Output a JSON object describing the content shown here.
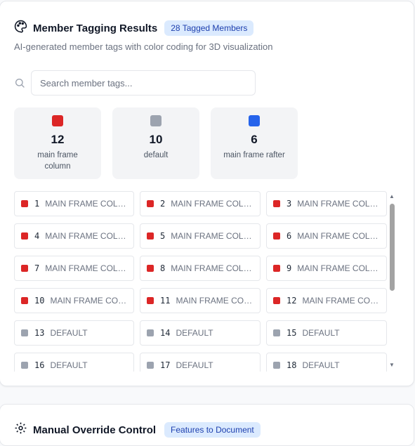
{
  "header": {
    "title": "Member Tagging Results",
    "badge": "28 Tagged Members",
    "subtitle": "AI-generated member tags with color coding for 3D visualization"
  },
  "search": {
    "placeholder": "Search member tags..."
  },
  "colors": {
    "red": "#dc2626",
    "gray": "#9ca3af",
    "blue": "#2563eb"
  },
  "stats": [
    {
      "count": "12",
      "label": "main frame column",
      "color": "#dc2626"
    },
    {
      "count": "10",
      "label": "default",
      "color": "#9ca3af"
    },
    {
      "count": "6",
      "label": "main frame rafter",
      "color": "#2563eb"
    }
  ],
  "members": [
    {
      "num": "1",
      "label": "MAIN FRAME COLU...",
      "color": "#dc2626"
    },
    {
      "num": "2",
      "label": "MAIN FRAME COLU...",
      "color": "#dc2626"
    },
    {
      "num": "3",
      "label": "MAIN FRAME COLU...",
      "color": "#dc2626"
    },
    {
      "num": "4",
      "label": "MAIN FRAME COLU...",
      "color": "#dc2626"
    },
    {
      "num": "5",
      "label": "MAIN FRAME COLU...",
      "color": "#dc2626"
    },
    {
      "num": "6",
      "label": "MAIN FRAME COLU...",
      "color": "#dc2626"
    },
    {
      "num": "7",
      "label": "MAIN FRAME COLU...",
      "color": "#dc2626"
    },
    {
      "num": "8",
      "label": "MAIN FRAME COLU...",
      "color": "#dc2626"
    },
    {
      "num": "9",
      "label": "MAIN FRAME COLU...",
      "color": "#dc2626"
    },
    {
      "num": "10",
      "label": "MAIN FRAME COL...",
      "color": "#dc2626"
    },
    {
      "num": "11",
      "label": "MAIN FRAME COL...",
      "color": "#dc2626"
    },
    {
      "num": "12",
      "label": "MAIN FRAME COL...",
      "color": "#dc2626"
    },
    {
      "num": "13",
      "label": "DEFAULT",
      "color": "#9ca3af"
    },
    {
      "num": "14",
      "label": "DEFAULT",
      "color": "#9ca3af"
    },
    {
      "num": "15",
      "label": "DEFAULT",
      "color": "#9ca3af"
    },
    {
      "num": "16",
      "label": "DEFAULT",
      "color": "#9ca3af"
    },
    {
      "num": "17",
      "label": "DEFAULT",
      "color": "#9ca3af"
    },
    {
      "num": "18",
      "label": "DEFAULT",
      "color": "#9ca3af"
    }
  ],
  "section2": {
    "title": "Manual Override Control",
    "badge": "Features to Document"
  }
}
